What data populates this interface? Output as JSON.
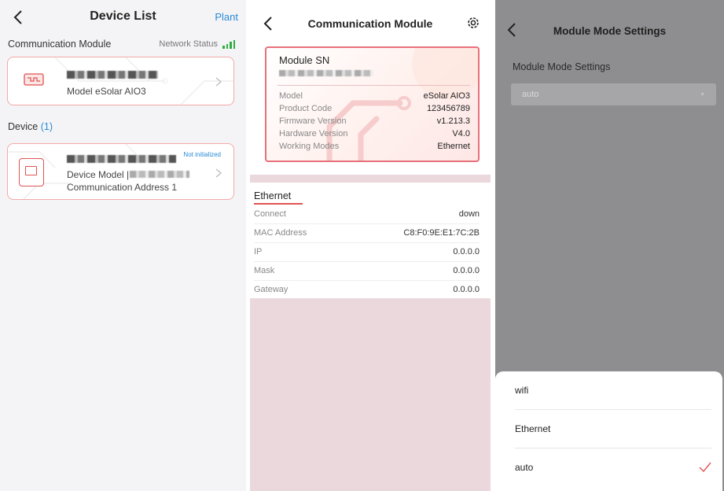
{
  "panel1": {
    "title": "Device List",
    "link": "Plant",
    "comm_section": "Communication Module",
    "network_status": "Network Status",
    "comm_card": {
      "model": "Model eSolar AIO3"
    },
    "device_section": "Device",
    "device_count": "(1)",
    "device_card": {
      "status": "Not initialized",
      "model_label": "Device Model |",
      "address": "Communication Address 1"
    }
  },
  "panel2": {
    "title": "Communication Module",
    "sn_label": "Module SN",
    "rows": [
      {
        "label": "Model",
        "value": "eSolar AIO3"
      },
      {
        "label": "Product Code",
        "value": "123456789"
      },
      {
        "label": "Firmware Version",
        "value": "v1.213.3"
      },
      {
        "label": "Hardware Version",
        "value": "V4.0"
      },
      {
        "label": "Working Modes",
        "value": "Ethernet"
      }
    ],
    "eth_title": "Ethernet",
    "eth_rows": [
      {
        "label": "Connect",
        "value": "down"
      },
      {
        "label": "MAC Address",
        "value": "C8:F0:9E:E1:7C:2B"
      },
      {
        "label": "IP",
        "value": "0.0.0.0"
      },
      {
        "label": "Mask",
        "value": "0.0.0.0"
      },
      {
        "label": "Gateway",
        "value": "0.0.0.0"
      }
    ]
  },
  "panel3": {
    "title": "Module Mode Settings",
    "section_label": "Module Mode Settings",
    "select_value": "auto",
    "options": [
      "wifi",
      "Ethernet",
      "auto"
    ],
    "selected": "auto"
  },
  "colors": {
    "accent_link": "#2a8ad6",
    "card_border": "#f4a9a9",
    "accent_red": "#e05252",
    "signal_green": "#2eae3f"
  }
}
